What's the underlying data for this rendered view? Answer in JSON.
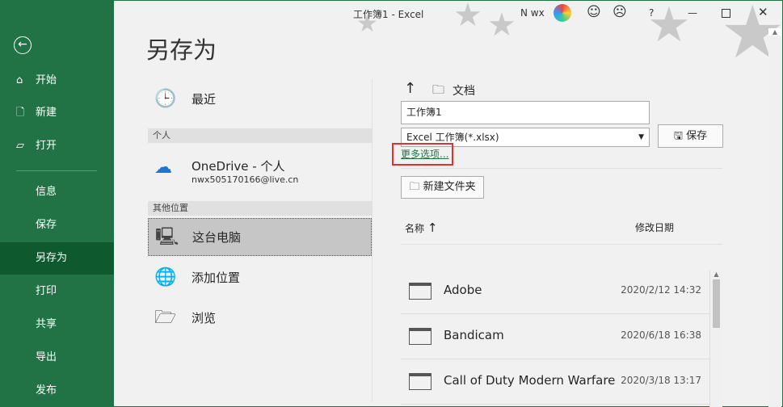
{
  "window": {
    "title": "工作簿1  -  Excel",
    "user": "N wx",
    "help": "?"
  },
  "sidebar": {
    "items": [
      {
        "label": "开始",
        "icon": "home-icon"
      },
      {
        "label": "新建",
        "icon": "new-file-icon"
      },
      {
        "label": "打开",
        "icon": "folder-open-icon"
      },
      {
        "label": "信息"
      },
      {
        "label": "保存"
      },
      {
        "label": "另存为"
      },
      {
        "label": "打印"
      },
      {
        "label": "共享"
      },
      {
        "label": "导出"
      },
      {
        "label": "发布"
      }
    ]
  },
  "page": {
    "title": "另存为"
  },
  "locations": {
    "recent": "最近",
    "personal_header": "个人",
    "onedrive": "OneDrive - 个人",
    "onedrive_email": "nwx505170166@live.cn",
    "other_header": "其他位置",
    "this_pc": "这台电脑",
    "add_place": "添加位置",
    "browse": "浏览"
  },
  "save": {
    "path": "文档",
    "filename": "工作簿1",
    "filetype": "Excel 工作簿(*.xlsx)",
    "save_label": "保存",
    "more_options": "更多选项...",
    "new_folder": "新建文件夹"
  },
  "files": {
    "col_name": "名称",
    "col_date": "修改日期",
    "rows": [
      {
        "name": "Adobe",
        "date": "2020/2/12 14:32"
      },
      {
        "name": "Bandicam",
        "date": "2020/6/18 16:38"
      },
      {
        "name": "Call of Duty Modern Warfare",
        "date": "2020/3/18 13:17"
      }
    ]
  }
}
